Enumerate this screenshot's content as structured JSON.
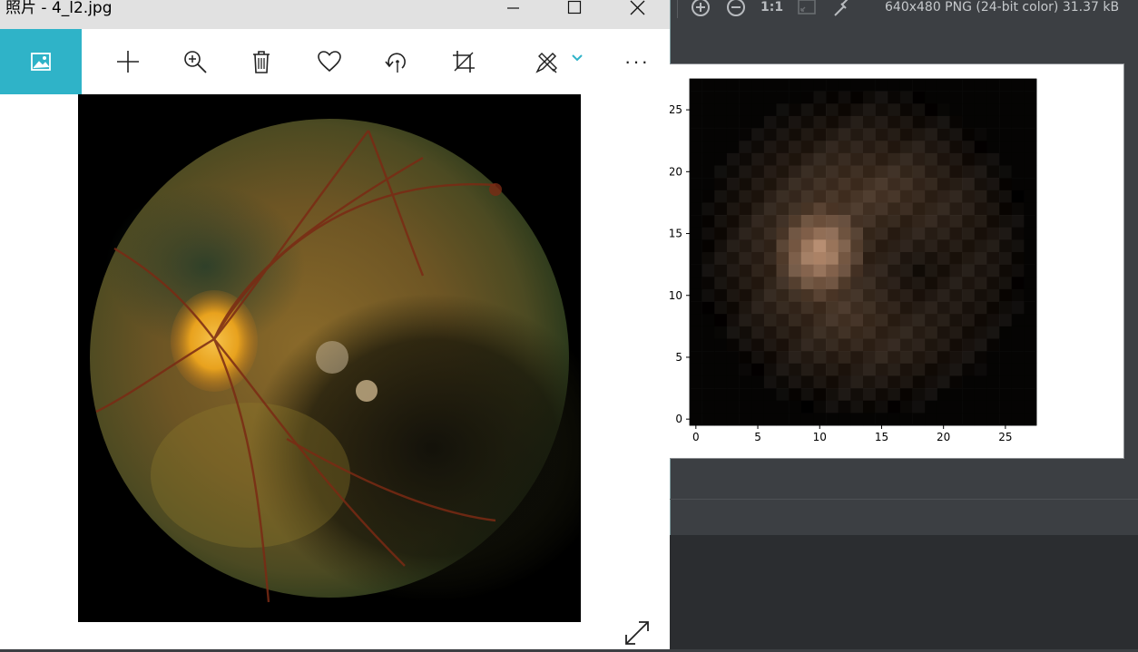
{
  "photos_app": {
    "title": "照片 - 4_l2.jpg",
    "window_controls": [
      "minimize-icon",
      "maximize-icon",
      "close-icon"
    ],
    "toolbar": {
      "items": [
        "view-image-icon",
        "add-icon",
        "zoom-in-icon",
        "delete-icon",
        "favorite-icon",
        "rotate-icon",
        "crop-icon",
        "edit-draw-icon",
        "chevron-down-icon",
        "more-icon"
      ]
    },
    "more_label": "···"
  },
  "viewer": {
    "toolbar_icons": [
      "zoom-in-icon",
      "zoom-out-icon",
      "actual-size-icon",
      "fit-icon",
      "eyedropper-icon"
    ],
    "actual_size_label": "1:1",
    "file_info": "640x480 PNG (24-bit color) 31.37 kB"
  },
  "chart_data": {
    "type": "heatmap",
    "title": "",
    "xlabel": "",
    "ylabel": "",
    "xlim": [
      -0.5,
      27.5
    ],
    "ylim": [
      27.5,
      -0.5
    ],
    "x_ticks": [
      "0",
      "5",
      "10",
      "15",
      "20",
      "25"
    ],
    "y_ticks": [
      "0",
      "5",
      "10",
      "15",
      "20",
      "25"
    ],
    "grid_size": [
      28,
      28
    ],
    "colors": {
      "bright_spot": "#c99a7a",
      "background": "#050403"
    }
  }
}
